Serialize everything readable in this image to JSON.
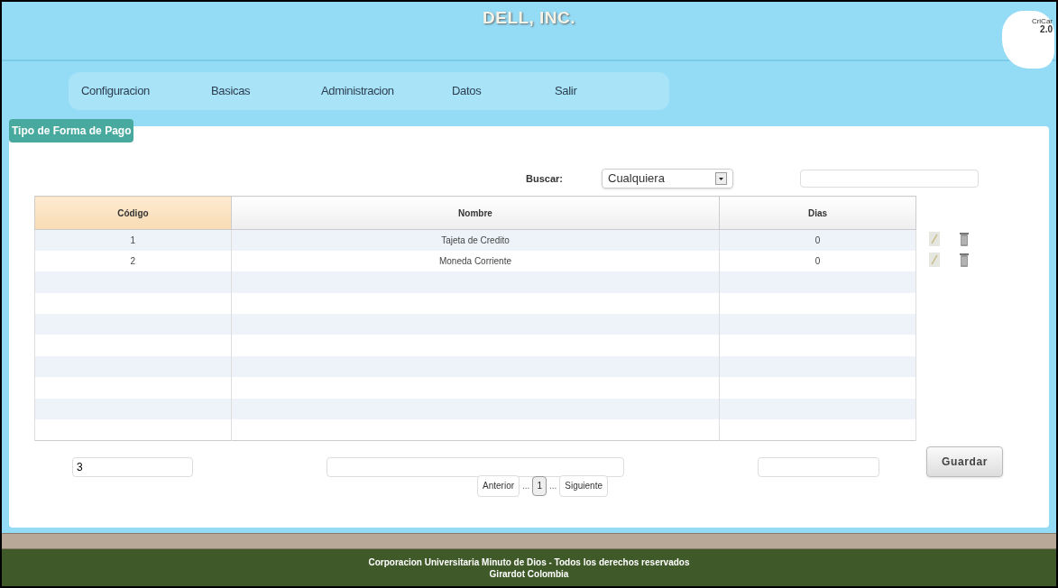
{
  "header": {
    "title": "DELL, INC.",
    "logo": {
      "caption": "CriCar",
      "version": "2.0"
    }
  },
  "nav": [
    {
      "label": "Configuracion"
    },
    {
      "label": "Basicas"
    },
    {
      "label": "Administracion"
    },
    {
      "label": "Datos"
    },
    {
      "label": "Salir"
    }
  ],
  "panel": {
    "title": "Tipo de Forma de Pago"
  },
  "search": {
    "label": "Buscar:",
    "filter": "Cualquiera"
  },
  "table": {
    "columns": [
      {
        "label": "Código",
        "sorted": true
      },
      {
        "label": "Nombre",
        "sorted": false
      },
      {
        "label": "Dias",
        "sorted": false
      }
    ],
    "rows": [
      [
        "1",
        "Tajeta de Credito",
        "0"
      ],
      [
        "2",
        "Moneda Corriente",
        "0"
      ]
    ]
  },
  "form": {
    "codigo": "3",
    "save": "Guardar"
  },
  "pagination": [
    {
      "kind": "prev",
      "label": "Anterior"
    },
    {
      "kind": "gap",
      "label": "..."
    },
    {
      "kind": "page",
      "label": "1",
      "selected": true
    },
    {
      "kind": "gap",
      "label": "..."
    },
    {
      "kind": "next",
      "label": "Siguiente"
    }
  ],
  "footer": {
    "lines": [
      "Corporacion Universitaria Minuto de Dios - Todos los derechos reservados",
      "Girardot Colombia"
    ]
  }
}
